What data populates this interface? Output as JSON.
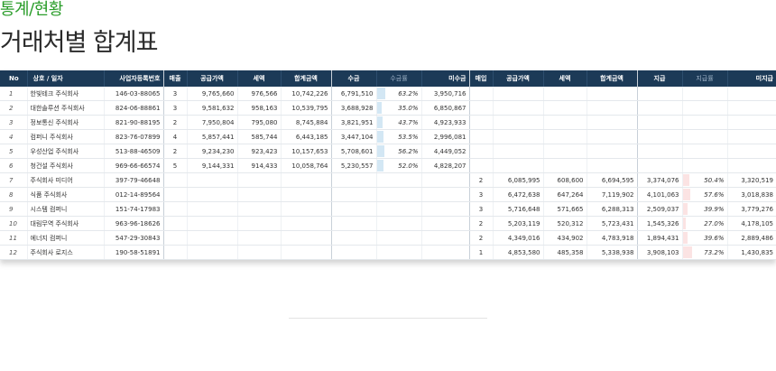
{
  "section_title": "통계/현황",
  "page_title": "거래처별 합계표",
  "colors": {
    "header_bg": "#1c3a57",
    "collect_rate": "#d3e7f4",
    "pay_rate": "#fbe3e3",
    "title_green": "#2a9d2a"
  },
  "columns": [
    "No",
    "상호 / 일자",
    "사업자등록번호",
    "매출",
    "공급가액",
    "세액",
    "합계금액",
    "수금",
    "수금률",
    "미수금",
    "매입",
    "공급가액",
    "세액",
    "합계금액",
    "지급",
    "지급률",
    "미지급"
  ],
  "rows": [
    {
      "no": "1",
      "name": "한빛테크 주식회사",
      "biz": "146-03-88065",
      "sales_cnt": "3",
      "sales_supply": "9,765,660",
      "sales_tax": "976,566",
      "sales_total": "10,742,226",
      "collect": "6,791,510",
      "collect_rate": "63.2%",
      "collect_rate_val": 63.2,
      "receivable": "3,950,716",
      "purchase_cnt": "",
      "purchase_supply": "",
      "purchase_tax": "",
      "purchase_total": "",
      "pay": "",
      "pay_rate": "",
      "pay_rate_val": 0,
      "unpaid": ""
    },
    {
      "no": "2",
      "name": "대한솔루션 주식회사",
      "biz": "824-06-88861",
      "sales_cnt": "3",
      "sales_supply": "9,581,632",
      "sales_tax": "958,163",
      "sales_total": "10,539,795",
      "collect": "3,688,928",
      "collect_rate": "35.0%",
      "collect_rate_val": 35.0,
      "receivable": "6,850,867",
      "purchase_cnt": "",
      "purchase_supply": "",
      "purchase_tax": "",
      "purchase_total": "",
      "pay": "",
      "pay_rate": "",
      "pay_rate_val": 0,
      "unpaid": ""
    },
    {
      "no": "3",
      "name": "정보통신 주식회사",
      "biz": "821-90-88195",
      "sales_cnt": "2",
      "sales_supply": "7,950,804",
      "sales_tax": "795,080",
      "sales_total": "8,745,884",
      "collect": "3,821,951",
      "collect_rate": "43.7%",
      "collect_rate_val": 43.7,
      "receivable": "4,923,933",
      "purchase_cnt": "",
      "purchase_supply": "",
      "purchase_tax": "",
      "purchase_total": "",
      "pay": "",
      "pay_rate": "",
      "pay_rate_val": 0,
      "unpaid": ""
    },
    {
      "no": "4",
      "name": "컴퍼니 주식회사",
      "biz": "823-76-07899",
      "sales_cnt": "4",
      "sales_supply": "5,857,441",
      "sales_tax": "585,744",
      "sales_total": "6,443,185",
      "collect": "3,447,104",
      "collect_rate": "53.5%",
      "collect_rate_val": 53.5,
      "receivable": "2,996,081",
      "purchase_cnt": "",
      "purchase_supply": "",
      "purchase_tax": "",
      "purchase_total": "",
      "pay": "",
      "pay_rate": "",
      "pay_rate_val": 0,
      "unpaid": ""
    },
    {
      "no": "5",
      "name": "우성산업 주식회사",
      "biz": "513-88-46509",
      "sales_cnt": "2",
      "sales_supply": "9,234,230",
      "sales_tax": "923,423",
      "sales_total": "10,157,653",
      "collect": "5,708,601",
      "collect_rate": "56.2%",
      "collect_rate_val": 56.2,
      "receivable": "4,449,052",
      "purchase_cnt": "",
      "purchase_supply": "",
      "purchase_tax": "",
      "purchase_total": "",
      "pay": "",
      "pay_rate": "",
      "pay_rate_val": 0,
      "unpaid": ""
    },
    {
      "no": "6",
      "name": "청건설 주식회사",
      "biz": "969-66-66574",
      "sales_cnt": "5",
      "sales_supply": "9,144,331",
      "sales_tax": "914,433",
      "sales_total": "10,058,764",
      "collect": "5,230,557",
      "collect_rate": "52.0%",
      "collect_rate_val": 52.0,
      "receivable": "4,828,207",
      "purchase_cnt": "",
      "purchase_supply": "",
      "purchase_tax": "",
      "purchase_total": "",
      "pay": "",
      "pay_rate": "",
      "pay_rate_val": 0,
      "unpaid": ""
    },
    {
      "no": "7",
      "name": "주식회사 미디어",
      "biz": "397-79-46648",
      "sales_cnt": "",
      "sales_supply": "",
      "sales_tax": "",
      "sales_total": "",
      "collect": "",
      "collect_rate": "",
      "collect_rate_val": 0,
      "receivable": "",
      "purchase_cnt": "2",
      "purchase_supply": "6,085,995",
      "purchase_tax": "608,600",
      "purchase_total": "6,694,595",
      "pay": "3,374,076",
      "pay_rate": "50.4%",
      "pay_rate_val": 50.4,
      "unpaid": "3,320,519"
    },
    {
      "no": "8",
      "name": "식품 주식회사",
      "biz": "012-14-89564",
      "sales_cnt": "",
      "sales_supply": "",
      "sales_tax": "",
      "sales_total": "",
      "collect": "",
      "collect_rate": "",
      "collect_rate_val": 0,
      "receivable": "",
      "purchase_cnt": "3",
      "purchase_supply": "6,472,638",
      "purchase_tax": "647,264",
      "purchase_total": "7,119,902",
      "pay": "4,101,063",
      "pay_rate": "57.6%",
      "pay_rate_val": 57.6,
      "unpaid": "3,018,838"
    },
    {
      "no": "9",
      "name": "시스템 컴퍼니",
      "biz": "151-74-17983",
      "sales_cnt": "",
      "sales_supply": "",
      "sales_tax": "",
      "sales_total": "",
      "collect": "",
      "collect_rate": "",
      "collect_rate_val": 0,
      "receivable": "",
      "purchase_cnt": "3",
      "purchase_supply": "5,716,648",
      "purchase_tax": "571,665",
      "purchase_total": "6,288,313",
      "pay": "2,509,037",
      "pay_rate": "39.9%",
      "pay_rate_val": 39.9,
      "unpaid": "3,779,276"
    },
    {
      "no": "10",
      "name": "대림무역 주식회사",
      "biz": "963-96-18626",
      "sales_cnt": "",
      "sales_supply": "",
      "sales_tax": "",
      "sales_total": "",
      "collect": "",
      "collect_rate": "",
      "collect_rate_val": 0,
      "receivable": "",
      "purchase_cnt": "2",
      "purchase_supply": "5,203,119",
      "purchase_tax": "520,312",
      "purchase_total": "5,723,431",
      "pay": "1,545,326",
      "pay_rate": "27.0%",
      "pay_rate_val": 27.0,
      "unpaid": "4,178,105"
    },
    {
      "no": "11",
      "name": "에너지 컴퍼니",
      "biz": "547-29-30843",
      "sales_cnt": "",
      "sales_supply": "",
      "sales_tax": "",
      "sales_total": "",
      "collect": "",
      "collect_rate": "",
      "collect_rate_val": 0,
      "receivable": "",
      "purchase_cnt": "2",
      "purchase_supply": "4,349,016",
      "purchase_tax": "434,902",
      "purchase_total": "4,783,918",
      "pay": "1,894,431",
      "pay_rate": "39.6%",
      "pay_rate_val": 39.6,
      "unpaid": "2,889,486"
    },
    {
      "no": "12",
      "name": "주식회사 로지스",
      "biz": "190-58-51891",
      "sales_cnt": "",
      "sales_supply": "",
      "sales_tax": "",
      "sales_total": "",
      "collect": "",
      "collect_rate": "",
      "collect_rate_val": 0,
      "receivable": "",
      "purchase_cnt": "1",
      "purchase_supply": "4,853,580",
      "purchase_tax": "485,358",
      "purchase_total": "5,338,938",
      "pay": "3,908,103",
      "pay_rate": "73.2%",
      "pay_rate_val": 73.2,
      "unpaid": "1,430,835"
    }
  ]
}
